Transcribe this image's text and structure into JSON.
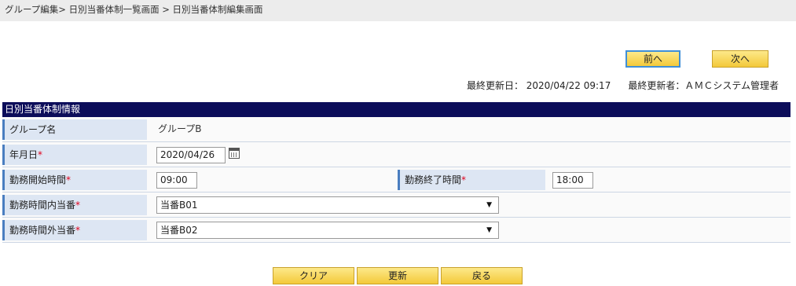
{
  "breadcrumb": "グループ編集> 日別当番体制一覧画面 > 日別当番体制編集画面",
  "nav": {
    "prev_label": "前へ",
    "next_label": "次へ"
  },
  "meta": {
    "updated_at": "最終更新日： 2020/04/22 09:17",
    "updated_by": "最終更新者：ＡＭＣシステム管理者"
  },
  "section": {
    "title": "日別当番体制情報",
    "group_name_label": "グループ名",
    "group_name_value": "グループB",
    "date_label": "年月日",
    "date_value": "2020/04/26",
    "start_label": "勤務開始時間",
    "start_value": "09:00",
    "end_label": "勤務終了時間",
    "end_value": "18:00",
    "in_duty_label": "勤務時間内当番",
    "in_duty_value": "当番B01",
    "out_duty_label": "勤務時間外当番",
    "out_duty_value": "当番B02",
    "required_mark": "*"
  },
  "actions": {
    "clear_label": "クリア",
    "update_label": "更新",
    "back_label": "戻る"
  },
  "icons": {
    "calendar": "calendar-icon",
    "dropdown": "chevron-down-icon"
  }
}
